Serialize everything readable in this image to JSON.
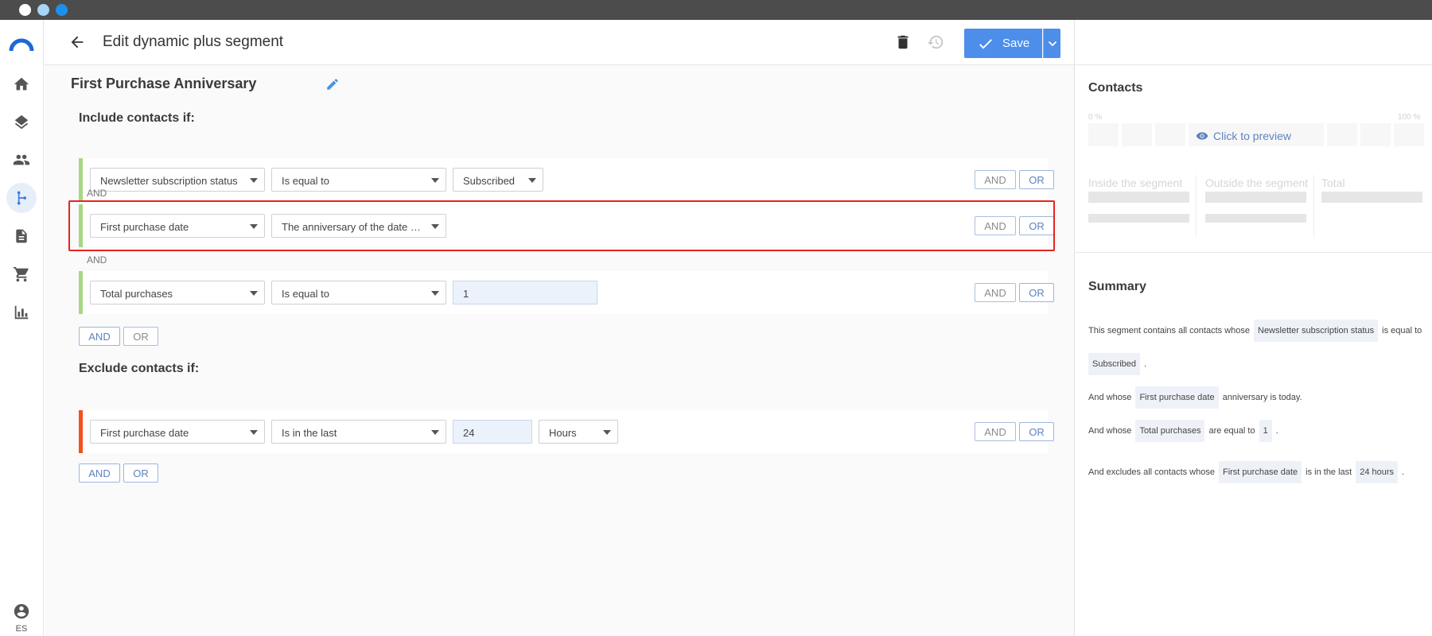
{
  "header": {
    "title": "Edit dynamic plus segment",
    "save_label": "Save"
  },
  "segment": {
    "name": "First Purchase Anniversary"
  },
  "sidebar": {
    "user_initials": "ES"
  },
  "include": {
    "title": "Include contacts if:",
    "rules": [
      {
        "field": "Newsletter subscription status",
        "operator": "Is equal to",
        "value": "Subscribed"
      },
      {
        "field": "First purchase date",
        "operator": "The anniversary of the date …"
      },
      {
        "field": "Total purchases",
        "operator": "Is equal to",
        "value": "1"
      }
    ],
    "join": "AND"
  },
  "exclude": {
    "title": "Exclude contacts if:",
    "rules": [
      {
        "field": "First purchase date",
        "operator": "Is in the last",
        "value": "24",
        "unit": "Hours"
      }
    ]
  },
  "buttons": {
    "and": "AND",
    "or": "OR"
  },
  "contacts": {
    "title": "Contacts",
    "pct_min": "0 %",
    "pct_max": "100 %",
    "preview": "Click to preview",
    "inside": "Inside the segment",
    "outside": "Outside the segment",
    "total": "Total"
  },
  "summary": {
    "title": "Summary",
    "l1_pre": "This segment contains all contacts whose",
    "l1_chip": "Newsletter subscription status",
    "l1_post": "is equal to",
    "l2_chip": "Subscribed",
    "l2_post": ".",
    "l3_pre": "And whose",
    "l3_chip": "First purchase date",
    "l3_post": "anniversary is today.",
    "l4_pre": "And whose",
    "l4_chip": "Total purchases",
    "l4_mid": "are equal to",
    "l4_chip2": "1",
    "l4_post": ".",
    "l5_pre": "And excludes all contacts whose",
    "l5_chip": "First purchase date",
    "l5_mid": "is in the last",
    "l5_chip2": "24 hours",
    "l5_post": "."
  },
  "colors": {
    "accent": "#4d8eea",
    "include_bar": "#a6d785",
    "exclude_bar": "#f4511e",
    "highlight": "#e8231f"
  },
  "icons": [
    "back-arrow-icon",
    "trash-icon",
    "history-icon",
    "check-icon",
    "chevron-down-icon",
    "pencil-icon",
    "eye-icon",
    "home-icon",
    "layers-icon",
    "people-icon",
    "segment-icon",
    "document-icon",
    "cart-icon",
    "bar-chart-icon",
    "user-circle-icon",
    "logo-icon"
  ]
}
